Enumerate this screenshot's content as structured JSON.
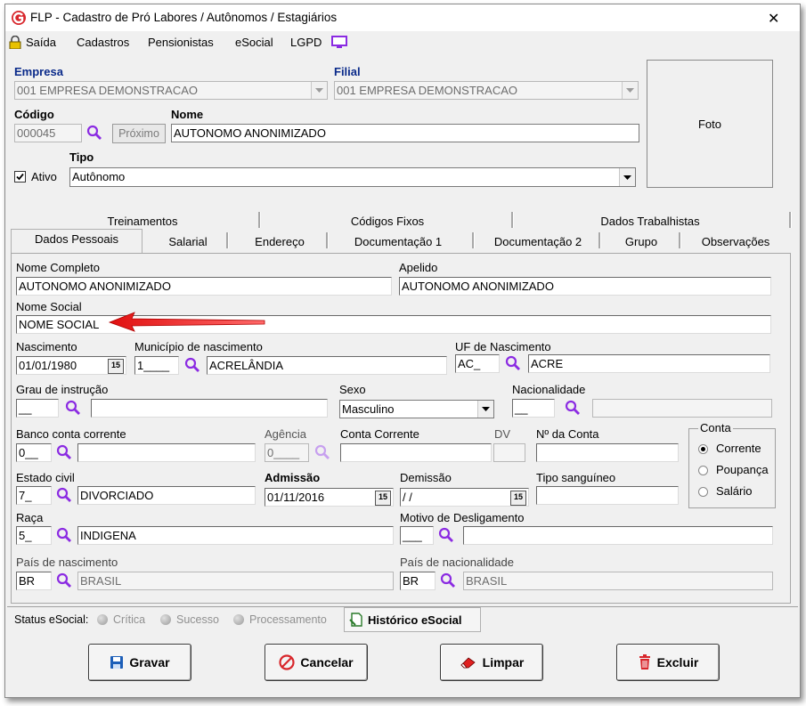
{
  "window": {
    "title": "FLP - Cadastro de Pró Labores / Autônomos / Estagiários",
    "close_glyph": "✕"
  },
  "menu": {
    "items": [
      "Saída",
      "Cadastros",
      "Pensionistas",
      "eSocial",
      "LGPD"
    ]
  },
  "header": {
    "empresa_label": "Empresa",
    "empresa_value": "001 EMPRESA DEMONSTRACAO",
    "filial_label": "Filial",
    "filial_value": "001 EMPRESA DEMONSTRACAO",
    "codigo_label": "Código",
    "codigo_value": "000045",
    "proximo_label": "Próximo",
    "nome_label": "Nome",
    "nome_value": "AUTONOMO ANONIMIZADO",
    "ativo_label": "Ativo",
    "tipo_label": "Tipo",
    "tipo_value": "Autônomo",
    "foto_label": "Foto"
  },
  "tabs": {
    "top": [
      "Treinamentos",
      "Códigos Fixos",
      "Dados Trabalhistas"
    ],
    "bottom": [
      "Dados Pessoais",
      "Salarial",
      "Endereço",
      "Documentação 1",
      "Documentação 2",
      "Grupo",
      "Observações"
    ]
  },
  "form": {
    "nome_completo_label": "Nome Completo",
    "nome_completo": "AUTONOMO ANONIMIZADO",
    "apelido_label": "Apelido",
    "apelido": "AUTONOMO ANONIMIZADO",
    "nome_social_label": "Nome Social",
    "nome_social": "NOME SOCIAL",
    "nascimento_label": "Nascimento",
    "nascimento": "01/01/1980",
    "municipio_label": "Município de nascimento",
    "municipio_code": "1____",
    "municipio": "ACRELÂNDIA",
    "uf_label": "UF de Nascimento",
    "uf_code": "AC_",
    "uf": "ACRE",
    "grau_label": "Grau de instrução",
    "grau_code": "__",
    "sexo_label": "Sexo",
    "sexo": "Masculino",
    "nacionalidade_label": "Nacionalidade",
    "nacionalidade_code": "__",
    "banco_label": "Banco conta corrente",
    "banco_code": "0__",
    "agencia_label": "Agência",
    "agencia_code": "0____",
    "conta_corrente_label": "Conta Corrente",
    "dv_label": "DV",
    "numero_conta_label": "Nº da Conta",
    "conta_group_label": "Conta",
    "conta_options": [
      "Corrente",
      "Poupança",
      "Salário"
    ],
    "estado_civil_label": "Estado civil",
    "estado_civil_code": "7_",
    "estado_civil": "DIVORCIADO",
    "admissao_label": "Admissão",
    "admissao": "01/11/2016",
    "demissao_label": "Demissão",
    "demissao": " / /",
    "tipo_sanguineo_label": "Tipo sanguíneo",
    "raca_label": "Raça",
    "raca_code": "5_",
    "raca": "INDIGENA",
    "motivo_label": "Motivo de Desligamento",
    "motivo_code": "___",
    "pais_nasc_label": "País de nascimento",
    "pais_nasc_code": "BR",
    "pais_nasc": "BRASIL",
    "pais_nac_label": "País de nacionalidade",
    "pais_nac_code": "BR",
    "pais_nac": "BRASIL"
  },
  "status": {
    "label": "Status eSocial:",
    "items": [
      "Crítica",
      "Sucesso",
      "Processamento"
    ],
    "historico": "Histórico eSocial"
  },
  "buttons": {
    "gravar": "Gravar",
    "cancelar": "Cancelar",
    "limpar": "Limpar",
    "excluir": "Excluir"
  },
  "colors": {
    "accent_blue": "#0a2a8a",
    "purple_icon": "#8b2be2",
    "arrow_red": "#e01010",
    "logo_red": "#d8262b"
  }
}
